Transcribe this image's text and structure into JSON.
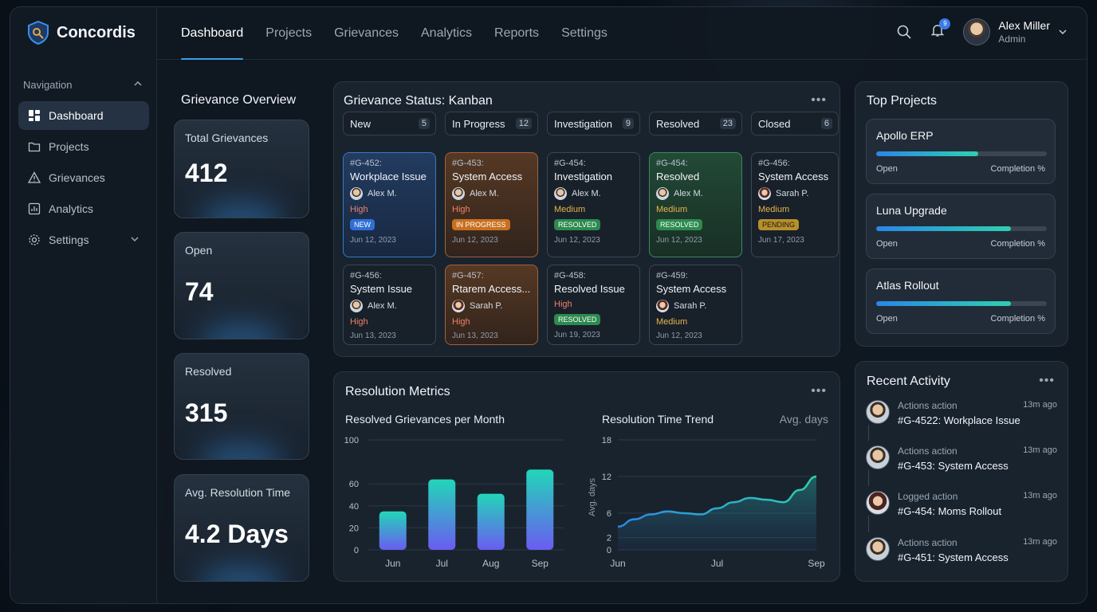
{
  "app": {
    "name": "Concordis"
  },
  "sidebar": {
    "heading": "Navigation",
    "items": [
      {
        "label": "Dashboard",
        "icon": "grid-icon",
        "active": true
      },
      {
        "label": "Projects",
        "icon": "folder-icon"
      },
      {
        "label": "Grievances",
        "icon": "warning-icon"
      },
      {
        "label": "Analytics",
        "icon": "bar-chart-icon"
      },
      {
        "label": "Settings",
        "icon": "gear-icon"
      }
    ]
  },
  "topnav": {
    "tabs": [
      "Dashboard",
      "Projects",
      "Grievances",
      "Analytics",
      "Reports",
      "Settings"
    ],
    "notification_count": "9",
    "user": {
      "name": "Alex Miller",
      "role": "Admin"
    }
  },
  "overview": {
    "title": "Grievance Overview",
    "stats": [
      {
        "label": "Total Grievances",
        "value": "412"
      },
      {
        "label": "Open",
        "value": "74"
      },
      {
        "label": "Resolved",
        "value": "315"
      },
      {
        "label": "Avg. Resolution Time",
        "value": "4.2 Days"
      }
    ]
  },
  "kanban": {
    "title": "Grievance Status: Kanban",
    "columns": [
      {
        "label": "New",
        "count": "5"
      },
      {
        "label": "In Progress",
        "count": "12"
      },
      {
        "label": "Investigation",
        "count": "9"
      },
      {
        "label": "Resolved",
        "count": "23"
      },
      {
        "label": "Closed",
        "count": "6"
      }
    ],
    "cards": [
      {
        "id": "#G-452:",
        "title": "Workplace Issue",
        "person": "Alex M.",
        "priority": "High",
        "status": "NEW",
        "date": "Jun 12, 2023"
      },
      {
        "id": "#G-453:",
        "title": "System Access",
        "person": "Alex M.",
        "priority": "High",
        "status": "IN PROGRESS",
        "date": "Jun 12, 2023"
      },
      {
        "id": "#G-454:",
        "title": "Investigation",
        "person": "Alex M.",
        "priority": "Medium",
        "status": "RESOLVED",
        "date": "Jun 12, 2023"
      },
      {
        "id": "#G-454:",
        "title": "Resolved",
        "person": "Alex M.",
        "priority": "Medium",
        "status": "RESOLVED",
        "date": "Jun 12, 2023"
      },
      {
        "id": "#G-456:",
        "title": "System Access",
        "person": "Sarah P.",
        "priority": "Medium",
        "status": "PENDING",
        "date": "Jun 17, 2023"
      },
      {
        "id": "#G-456:",
        "title": "System Issue",
        "person": "Alex M.",
        "priority": "High",
        "status": "",
        "date": "Jun 13, 2023"
      },
      {
        "id": "#G-457:",
        "title": "Rtarem Access...",
        "person": "Sarah P.",
        "priority": "High",
        "status": "",
        "date": "Jun 13, 2023"
      },
      {
        "id": "#G-458:",
        "title": "Resolved Issue",
        "person": "",
        "priority": "High",
        "status": "RESOLVED",
        "date": "Jun 19, 2023"
      },
      {
        "id": "#G-459:",
        "title": "System Access",
        "person": "Sarah P.",
        "priority": "Medium",
        "status": "",
        "date": "Jun 12, 2023"
      }
    ]
  },
  "metrics": {
    "title": "Resolution Metrics",
    "bar_title": "Resolved Grievances per Month",
    "line_title": "Resolution Time Trend",
    "line_unit": "Avg. days"
  },
  "chart_data": [
    {
      "type": "bar",
      "title": "Resolved Grievances per Month",
      "categories": [
        "Jun",
        "Jul",
        "Aug",
        "Sep"
      ],
      "values": [
        35,
        64,
        51,
        73
      ],
      "yticks": [
        0,
        20,
        40,
        60,
        100
      ],
      "ylim": [
        0,
        100
      ],
      "xlabel": "",
      "ylabel": ""
    },
    {
      "type": "area",
      "title": "Resolution Time Trend",
      "x": [
        "Jun",
        "",
        "",
        "",
        "",
        "",
        "Jul",
        "",
        "",
        "",
        "",
        "",
        "Sep"
      ],
      "values": [
        3.8,
        5.0,
        5.8,
        6.3,
        6.0,
        5.8,
        6.8,
        7.8,
        8.5,
        8.2,
        7.8,
        9.8,
        12.0
      ],
      "xticks": [
        "Jun",
        "Jul",
        "Sep"
      ],
      "yticks": [
        0,
        2,
        6,
        12,
        18
      ],
      "ylim": [
        0,
        18
      ],
      "ylabel": "Avg. days",
      "xlabel": ""
    }
  ],
  "projects": {
    "title": "Top Projects",
    "items": [
      {
        "name": "Apollo ERP",
        "progress": 0.6,
        "open_label": "Open",
        "completion_label": "Completion %"
      },
      {
        "name": "Luna Upgrade",
        "progress": 0.79,
        "open_label": "Open",
        "completion_label": "Completion %"
      },
      {
        "name": "Atlas Rollout",
        "progress": 0.79,
        "open_label": "Open",
        "completion_label": "Completion %"
      }
    ]
  },
  "activity": {
    "title": "Recent Activity",
    "items": [
      {
        "type": "Actions action",
        "text": "#G-4522: Workplace Issue",
        "time": "13m ago"
      },
      {
        "type": "Actions action",
        "text": "#G-453: System Access",
        "time": "13m ago"
      },
      {
        "type": "Logged action",
        "text": "#G-454: Moms Rollout",
        "time": "13m ago"
      },
      {
        "type": "Actions action",
        "text": "#G-451: System Access",
        "time": "13m ago"
      }
    ]
  },
  "colors": {
    "accent": "#3b9ee8",
    "teal": "#2ed0b0",
    "violet": "#6a5cf0",
    "high": "#f0806a",
    "medium": "#e7b54a"
  }
}
